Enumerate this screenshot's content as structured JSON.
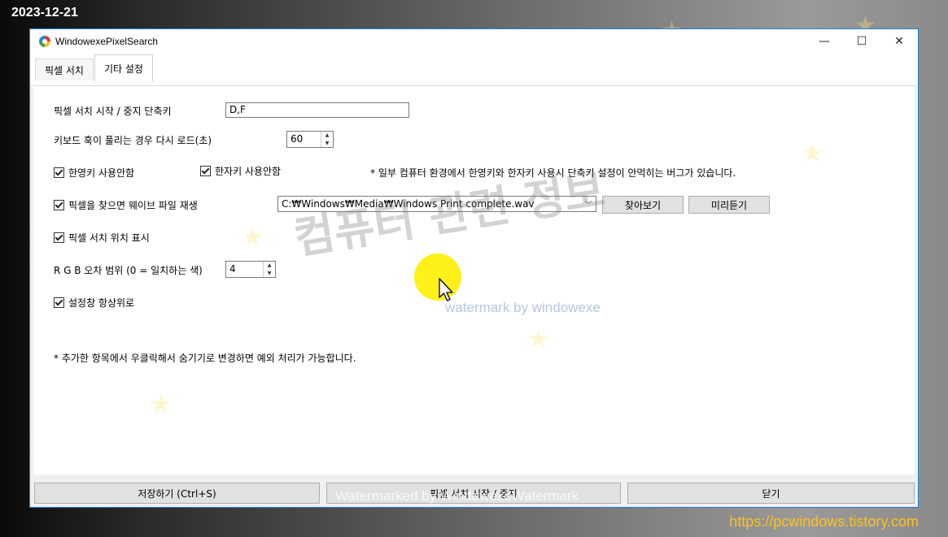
{
  "overlay": {
    "date": "2023-12-21",
    "url": "https://pcwindows.tistory.com",
    "watermark_main": "컴퓨터 관련 정보",
    "watermark_sub": "watermark by windowexe",
    "watermark_button": "Watermarked by WindowexeWatermark"
  },
  "window": {
    "title": "WindowexePixelSearch",
    "minimize": "—",
    "maximize": "☐",
    "close": "✕"
  },
  "tabs": [
    {
      "label": "픽셀 서치",
      "active": false
    },
    {
      "label": "기타 설정",
      "active": true
    }
  ],
  "settings": {
    "hotkey_label": "픽셀 서치 시작 / 중지 단축키",
    "hotkey_value": "D,F",
    "reload_label": "키보드 훅이 풀리는 경우 다시 로드(초)",
    "reload_value": "60",
    "hangul_key_label": "한영키 사용안함",
    "hanja_key_label": "한자키 사용안함",
    "bug_note": "* 일부 컴퓨터 환경에서 한영키와 한자키 사용시 단축키 설정이 안먹히는 버그가 있습니다.",
    "play_wave_label": "픽셀을 찾으면 웨이브 파일 재생",
    "wave_path": "C:₩Windows₩Media₩Windows Print complete.wav",
    "browse_button": "찾아보기",
    "preview_button": "미리듣기",
    "show_position_label": "픽셀 서치 위치 표시",
    "rgb_label": "R G B 오차 범위 (0 = 일치하는 색)",
    "rgb_value": "4",
    "always_on_top_label": "설정창 항상위로",
    "exception_note": "* 추가한 항목에서 우클릭해서 숨기기로 변경하면 예외 처리가 가능합니다."
  },
  "footer": {
    "save_button": "저장하기 (Ctrl+S)",
    "toggle_button": "픽셀 서치 시작 / 중지",
    "close_button": "닫기"
  }
}
